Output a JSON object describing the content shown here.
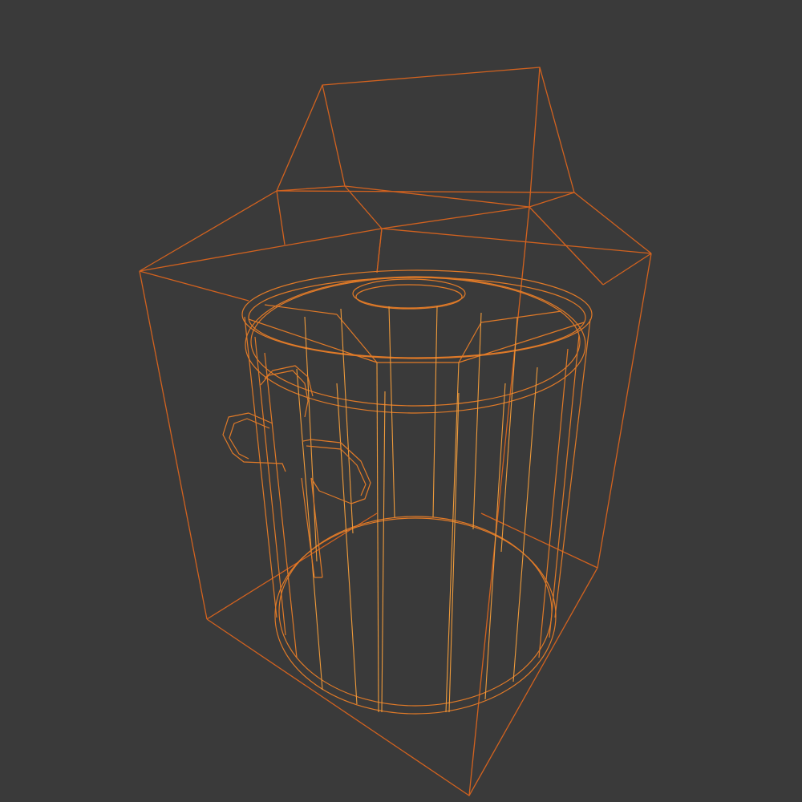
{
  "viewport": {
    "mode": "wireframe",
    "background_color": "#3a3a3a",
    "wire_color": "#e07a28",
    "cage_color": "#d2621f",
    "highlight_color": "#ee9a3a"
  },
  "scene": {
    "objects": [
      "bounding-cage",
      "bucket",
      "handle"
    ]
  }
}
